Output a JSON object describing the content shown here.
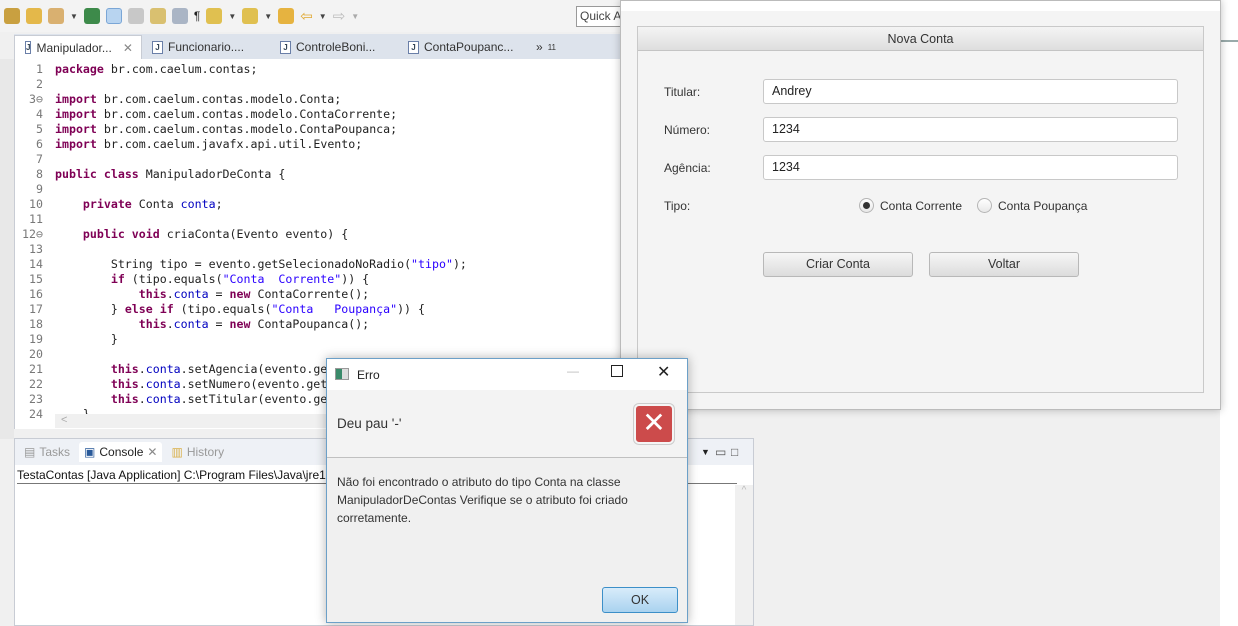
{
  "ide": {
    "quick_access": "Quick A",
    "tabs": [
      {
        "label": "Manipulador...",
        "active": true
      },
      {
        "label": "Funcionario...."
      },
      {
        "label": "ControleBoni..."
      },
      {
        "label": "ContaPoupanc..."
      }
    ],
    "overflow_tabs": "»",
    "overflow_count": "11",
    "code_lines": [
      "package br.com.caelum.contas;",
      "",
      "import br.com.caelum.contas.modelo.Conta;",
      "import br.com.caelum.contas.modelo.ContaCorrente;",
      "import br.com.caelum.contas.modelo.ContaPoupanca;",
      "import br.com.caelum.javafx.api.util.Evento;",
      "",
      "public class ManipuladorDeConta {",
      "",
      "    private Conta conta;",
      "",
      "    public void criaConta(Evento evento) {",
      "",
      "        String tipo = evento.getSelecionadoNoRadio(\"tipo\");",
      "        if (tipo.equals(\"Conta  Corrente\")) {",
      "            this.conta = new ContaCorrente();",
      "        } else if (tipo.equals(\"Conta   Poupança\")) {",
      "            this.conta = new ContaPoupanca();",
      "        }",
      "",
      "        this.conta.setAgencia(evento.ge",
      "        this.conta.setNumero(evento.get",
      "        this.conta.setTitular(evento.ge",
      "    }"
    ],
    "bottom_tabs": [
      {
        "label": "Tasks"
      },
      {
        "label": "Console",
        "active": true
      },
      {
        "label": "History"
      }
    ],
    "console_header": "TestaContas [Java Application] C:\\Program Files\\Java\\jre1.8"
  },
  "form": {
    "title": "Nova Conta",
    "fields": [
      {
        "label": "Titular:",
        "value": "Andrey"
      },
      {
        "label": "Número:",
        "value": "1234"
      },
      {
        "label": "Agência:",
        "value": "1234"
      }
    ],
    "tipo_label": "Tipo:",
    "radios": [
      {
        "label": "Conta Corrente",
        "selected": true
      },
      {
        "label": "Conta Poupança",
        "selected": false
      }
    ],
    "create_button": "Criar Conta",
    "back_button": "Voltar"
  },
  "dialog": {
    "title": "Erro",
    "header": "Deu pau '-'",
    "message": "Não foi encontrado o atributo do tipo Conta na classe ManipuladorDeContas Verifique se o atributo foi criado corretamente.",
    "ok_button": "OK",
    "error_color": "#cc4b4b"
  }
}
